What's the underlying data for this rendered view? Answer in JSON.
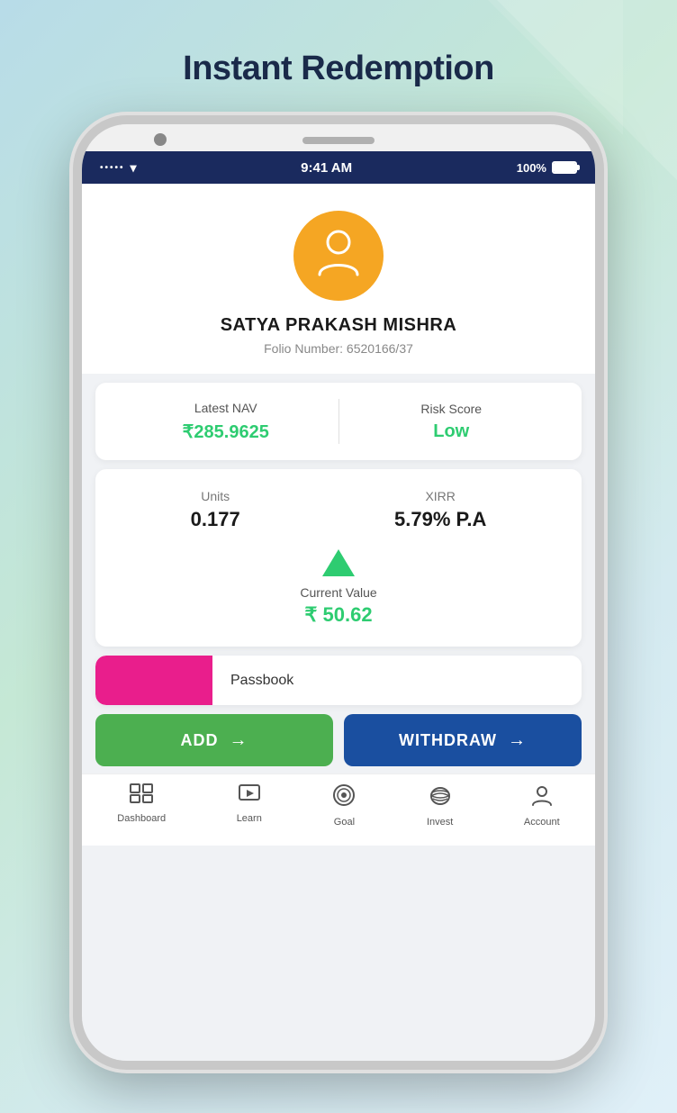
{
  "page": {
    "title": "Instant Redemption",
    "background": "gradient"
  },
  "status_bar": {
    "signal_dots": "•••••",
    "wifi": "wifi",
    "time": "9:41 AM",
    "battery_percent": "100%"
  },
  "profile": {
    "name": "SATYA PRAKASH MISHRA",
    "folio_label": "Folio Number:",
    "folio_number": "6520166/37"
  },
  "stats": {
    "nav_label": "Latest NAV",
    "nav_value": "₹285.9625",
    "risk_label": "Risk Score",
    "risk_value": "Low"
  },
  "investment": {
    "units_label": "Units",
    "units_value": "0.177",
    "xirr_label": "XIRR",
    "xirr_value": "5.79% P.A",
    "current_value_label": "Current Value",
    "current_value_amount": "₹ 50.62"
  },
  "passbook": {
    "label": "Passbook"
  },
  "buttons": {
    "add_label": "ADD",
    "add_arrow": "→",
    "withdraw_label": "WITHDRAW",
    "withdraw_arrow": "→"
  },
  "bottom_nav": {
    "items": [
      {
        "id": "dashboard",
        "icon": "⊞",
        "label": "Dashboard"
      },
      {
        "id": "learn",
        "icon": "🖥",
        "label": "Learn"
      },
      {
        "id": "goal",
        "icon": "🎯",
        "label": "Goal"
      },
      {
        "id": "invest",
        "icon": "🐷",
        "label": "Invest"
      },
      {
        "id": "account",
        "icon": "👤",
        "label": "Account"
      }
    ]
  }
}
